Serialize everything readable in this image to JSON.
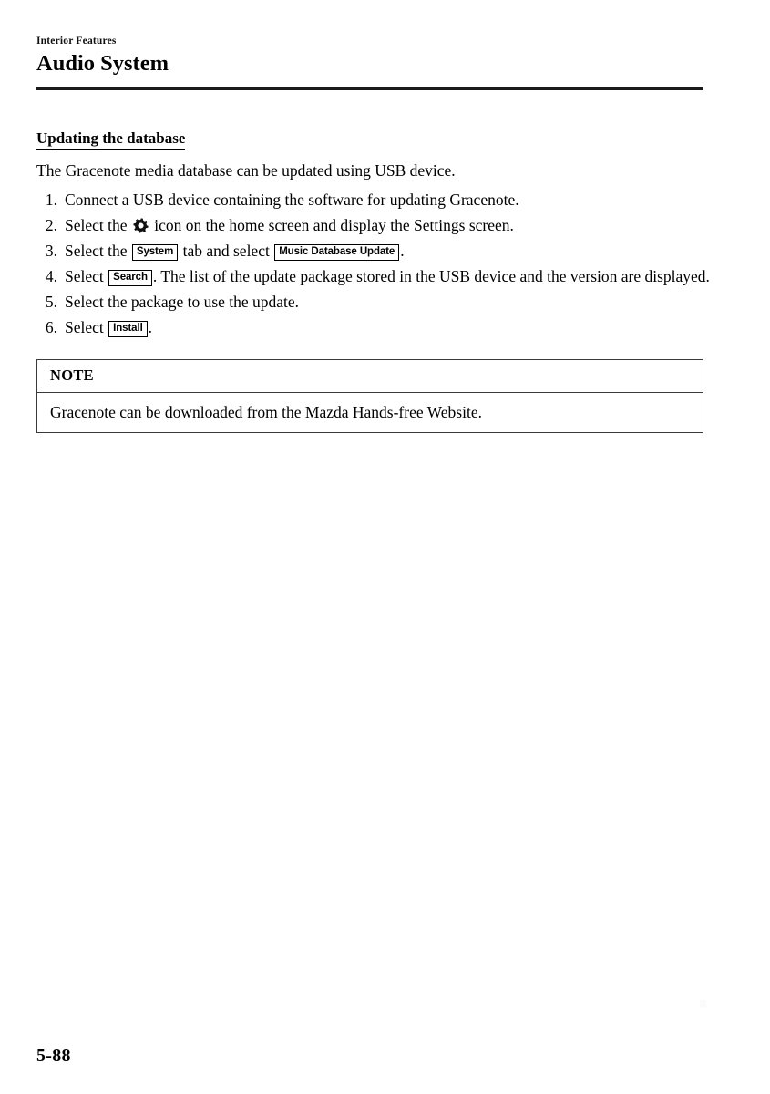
{
  "header": {
    "chapter_label": "Interior Features",
    "title": "Audio System"
  },
  "section": {
    "heading": "Updating the database",
    "intro": "The Gracenote media database can be updated using USB device."
  },
  "steps": [
    {
      "number": "1.",
      "parts": [
        {
          "type": "text",
          "value": "Connect a USB device containing the software for updating Gracenote."
        }
      ]
    },
    {
      "number": "2.",
      "parts": [
        {
          "type": "text",
          "value": "Select the "
        },
        {
          "type": "icon",
          "value": "gear-icon"
        },
        {
          "type": "text",
          "value": " icon on the home screen and display the Settings screen."
        }
      ]
    },
    {
      "number": "3.",
      "parts": [
        {
          "type": "text",
          "value": "Select the "
        },
        {
          "type": "key",
          "value": "System"
        },
        {
          "type": "text",
          "value": " tab and select "
        },
        {
          "type": "key",
          "value": "Music Database Update"
        },
        {
          "type": "text",
          "value": "."
        }
      ]
    },
    {
      "number": "4.",
      "parts": [
        {
          "type": "text",
          "value": "Select "
        },
        {
          "type": "key",
          "value": "Search"
        },
        {
          "type": "text",
          "value": ". The list of the update package stored in the USB device and the version are displayed."
        }
      ]
    },
    {
      "number": "5.",
      "parts": [
        {
          "type": "text",
          "value": "Select the package to use the update."
        }
      ]
    },
    {
      "number": "6.",
      "parts": [
        {
          "type": "text",
          "value": "Select "
        },
        {
          "type": "key",
          "value": "Install"
        },
        {
          "type": "text",
          "value": "."
        }
      ]
    }
  ],
  "note": {
    "label": "NOTE",
    "body": "Gracenote can be downloaded from the Mazda Hands-free Website."
  },
  "footer": {
    "page_number": "5-88"
  },
  "colors": {
    "text": "#000000",
    "rule": "#1a1a1a",
    "note_border": "#3a3a3a",
    "page_background": "#ffffff"
  }
}
